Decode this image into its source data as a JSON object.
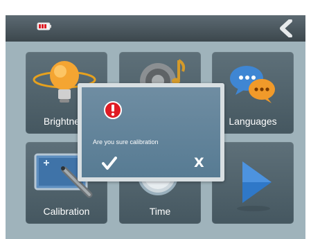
{
  "header": {
    "battery_icon": "battery-low-icon",
    "back_icon": "back-chevron-icon"
  },
  "tiles": [
    {
      "label": "Brightness",
      "icon": "brightness-bulb-icon"
    },
    {
      "label": "",
      "icon": "volume-music-icon"
    },
    {
      "label": "Languages",
      "icon": "languages-chat-icon"
    },
    {
      "label": "Calibration",
      "icon": "calibration-pen-icon"
    },
    {
      "label": "Time",
      "icon": "time-clock-icon"
    },
    {
      "label": "",
      "icon": "next-arrow-icon"
    }
  ],
  "dialog": {
    "message": "Are you sure calibration",
    "confirm_icon": "checkmark-icon",
    "cancel_label": "X",
    "alert_icon": "alert-icon"
  },
  "colors": {
    "accent": "#e01b24",
    "tile": "#54656e",
    "dialog": "#6a889d"
  }
}
